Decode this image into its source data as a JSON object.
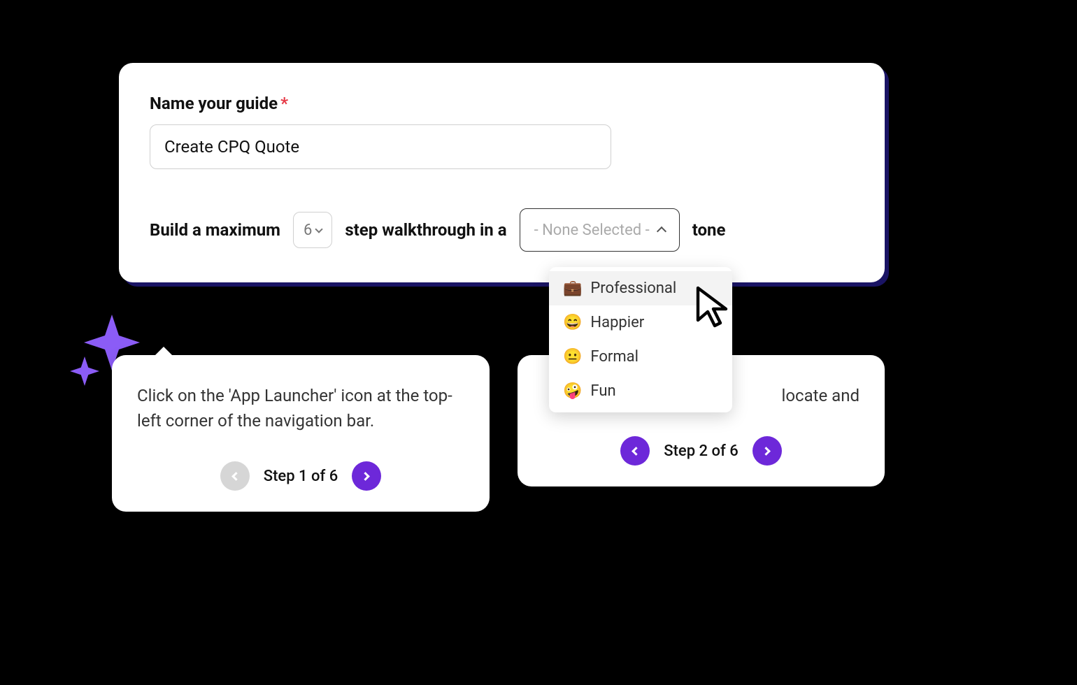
{
  "form": {
    "name_label": "Name your guide",
    "name_value": "Create CPQ Quote",
    "required_mark": "*",
    "build_prefix": "Build a maximum",
    "step_count": "6",
    "build_middle": "step walkthrough in a",
    "tone_placeholder": "- None Selected -",
    "build_suffix": "tone"
  },
  "tone_options": [
    {
      "emoji": "💼",
      "label": "Professional",
      "highlighted": true
    },
    {
      "emoji": "😄",
      "label": "Happier",
      "highlighted": false
    },
    {
      "emoji": "😐",
      "label": "Formal",
      "highlighted": false
    },
    {
      "emoji": "🤪",
      "label": "Fun",
      "highlighted": false
    }
  ],
  "tooltips": {
    "step1": {
      "text": "Click on the 'App Launcher' icon at the top-left corner of the navigation bar.",
      "step_label": "Step 1 of 6"
    },
    "step2": {
      "text_fragment": "locate and",
      "step_label": "Step 2 of 6"
    }
  },
  "colors": {
    "accent_purple": "#6d28d9",
    "sparkle": "#8b5cf6",
    "card_shadow": "#1a1464"
  }
}
